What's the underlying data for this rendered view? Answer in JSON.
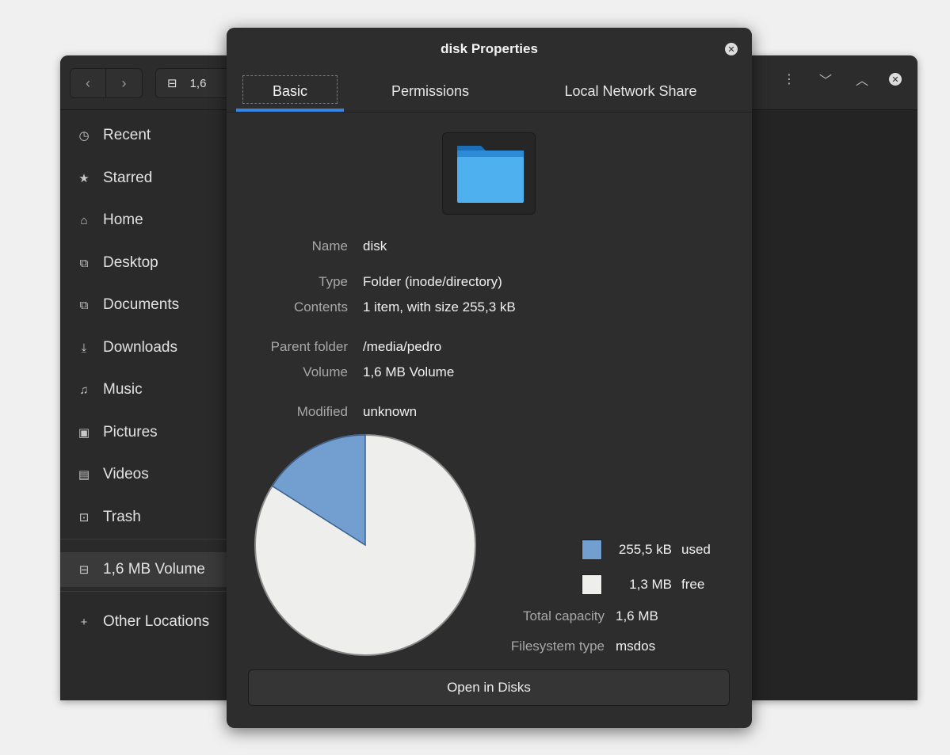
{
  "file_manager": {
    "location_label": "1,6",
    "sidebar": [
      {
        "label": "Recent",
        "icon": "clock-icon",
        "glyph": "◷"
      },
      {
        "label": "Starred",
        "icon": "star-icon",
        "glyph": "★"
      },
      {
        "label": "Home",
        "icon": "home-icon",
        "glyph": "⌂"
      },
      {
        "label": "Desktop",
        "icon": "desktop-icon",
        "glyph": "⧉"
      },
      {
        "label": "Documents",
        "icon": "documents-icon",
        "glyph": "⧉"
      },
      {
        "label": "Downloads",
        "icon": "download-icon",
        "glyph": "⤓"
      },
      {
        "label": "Music",
        "icon": "music-icon",
        "glyph": "♫"
      },
      {
        "label": "Pictures",
        "icon": "pictures-icon",
        "glyph": "▣"
      },
      {
        "label": "Videos",
        "icon": "videos-icon",
        "glyph": "▤"
      },
      {
        "label": "Trash",
        "icon": "trash-icon",
        "glyph": "⊡"
      },
      {
        "label": "1,6 MB Volume",
        "icon": "drive-icon",
        "glyph": "⊟",
        "active": true
      },
      {
        "label": "Other Locations",
        "icon": "plus-icon",
        "glyph": "+"
      }
    ]
  },
  "dialog": {
    "title": "disk Properties",
    "tabs": [
      "Basic",
      "Permissions",
      "Local Network Share"
    ],
    "active_tab": "Basic",
    "folder_colors": {
      "back": "#1a6fb6",
      "front": "#4fb0ef",
      "tab": "#2d8ad6"
    },
    "fields": {
      "name": {
        "label": "Name",
        "value": "disk"
      },
      "type": {
        "label": "Type",
        "value": "Folder (inode/directory)"
      },
      "contents": {
        "label": "Contents",
        "value": "1 item, with size 255,3 kB"
      },
      "parent": {
        "label": "Parent folder",
        "value": "/media/pedro"
      },
      "volume": {
        "label": "Volume",
        "value": "1,6 MB Volume"
      },
      "modified": {
        "label": "Modified",
        "value": "unknown"
      }
    },
    "usage": {
      "used_amount": "255,5 kB",
      "used_word": "used",
      "used_color": "#729fcf",
      "free_amount": "1,3 MB",
      "free_word": "free",
      "free_color": "#eeeeec",
      "used_fraction": 0.16
    },
    "capacity": {
      "label": "Total capacity",
      "value": "1,6 MB"
    },
    "filesystem": {
      "label": "Filesystem type",
      "value": "msdos"
    },
    "open_disks_label": "Open in Disks"
  }
}
